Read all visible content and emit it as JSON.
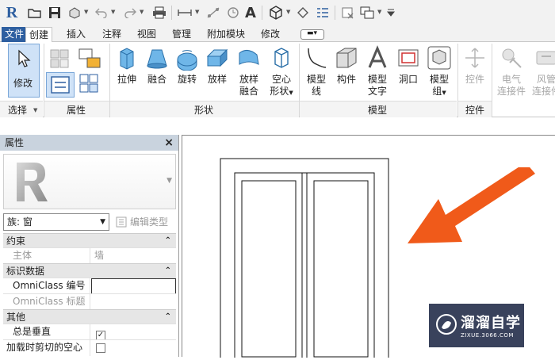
{
  "qat": {
    "app_logo": "R",
    "icons": [
      "open-icon",
      "save-icon",
      "sync-icon",
      "undo-icon",
      "redo-icon",
      "print-icon",
      "measure-icon",
      "dimension-icon",
      "tag-icon",
      "text-icon",
      "3d-view-icon",
      "section-icon",
      "thin-lines-icon",
      "close-hidden-icon",
      "switch-windows-icon",
      "customize-icon"
    ],
    "text_glyph": "A"
  },
  "tabs": {
    "file": "文件",
    "create": "创建",
    "insert": "插入",
    "annotate": "注释",
    "view": "视图",
    "manage": "管理",
    "addins": "附加模块",
    "modify": "修改"
  },
  "ribbon": {
    "modify_label": "修改",
    "select_panel": "选择",
    "properties_panel": "属性",
    "form_panel": "形状",
    "model_panel": "模型",
    "control_panel": "控件",
    "tools": {
      "extrusion": "拉伸",
      "blend": "融合",
      "revolve": "旋转",
      "sweep": "放样",
      "swept_blend_1": "放样",
      "swept_blend_2": "融合",
      "void_1": "空心",
      "void_2": "形状",
      "model_line_1": "模型",
      "model_line_2": "线",
      "component": "构件",
      "model_text_1": "模型",
      "model_text_2": "文字",
      "opening": "洞口",
      "model_group_1": "模型",
      "model_group_2": "组",
      "control": "控件",
      "elec_1": "电气",
      "elec_2": "连接件",
      "duct_1": "风管",
      "duct_2": "连接件"
    }
  },
  "properties": {
    "title": "属性",
    "close": "×",
    "family_type": "族: 窗",
    "edit_type": "编辑类型",
    "groups": {
      "constraints": "约束",
      "identity": "标识数据",
      "other": "其他"
    },
    "rows": {
      "host_k": "主体",
      "host_v": "墙",
      "omni_num_k": "OmniClass 编号",
      "omni_num_v": "",
      "omni_title_k": "OmniClass 标题",
      "omni_title_v": "",
      "always_vertical_k": "总是垂直",
      "always_vertical_checked": "✓",
      "cut_void_k": "加载时剪切的空心"
    }
  },
  "watermark": {
    "brand": "溜溜自学",
    "url": "ZIXUE.3066.COM"
  },
  "colors": {
    "arrow": "#f05a1a",
    "file_tab": "#2e5fa0",
    "title_bar": "#c9d3de",
    "select_highlight": "#cfe2f7"
  }
}
